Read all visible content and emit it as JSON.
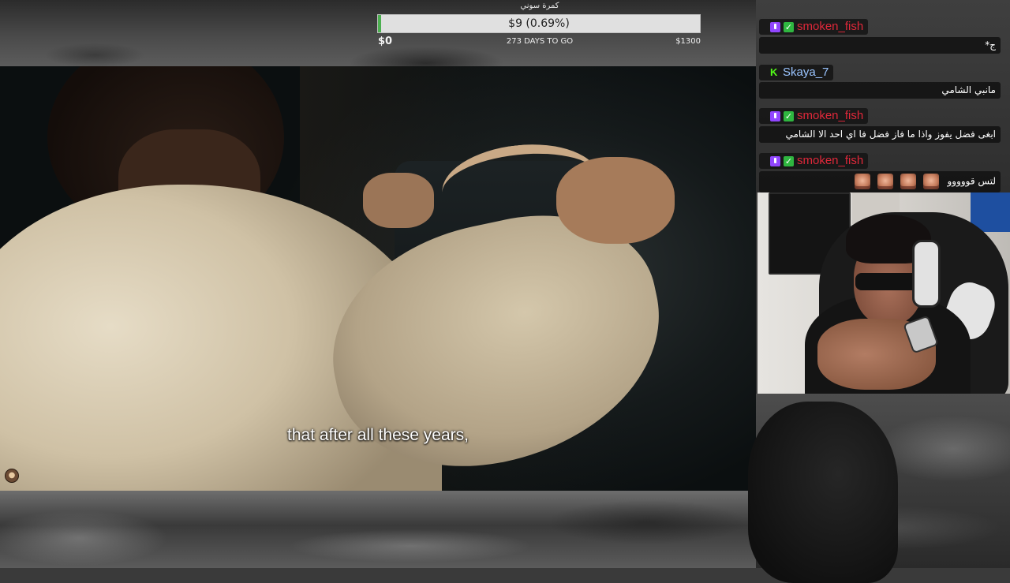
{
  "goal": {
    "title": "كمرة سوني",
    "amount": "$9 (0.69%)",
    "progress_fraction": 0.0069,
    "start_label": "$0",
    "days_label": "273 DAYS TO GO",
    "end_label": "$1300",
    "fill_color": "#4caf50"
  },
  "video": {
    "subtitle": "that after all these years,"
  },
  "chat": {
    "messages": [
      {
        "user": "smoken_fish",
        "user_color": "#e0283a",
        "platform": "twitch",
        "text": "ج*",
        "emotes": 0
      },
      {
        "user": "Skaya_7",
        "user_color": "#9ac4ff",
        "platform": "kick",
        "text": "مانبي الشامي",
        "emotes": 0
      },
      {
        "user": "smoken_fish",
        "user_color": "#e0283a",
        "platform": "twitch",
        "text": "ابغى فضل يفوز واذا ما فاز فضل فا اي احد الا الشامي",
        "emotes": 0
      },
      {
        "user": "smoken_fish",
        "user_color": "#e0283a",
        "platform": "twitch",
        "text": "لتس قووووو",
        "emotes": 4
      }
    ]
  },
  "icons": {
    "twitch_badge": "twitch-icon",
    "verified_badge": "check-icon",
    "kick_badge": "kick-icon"
  }
}
